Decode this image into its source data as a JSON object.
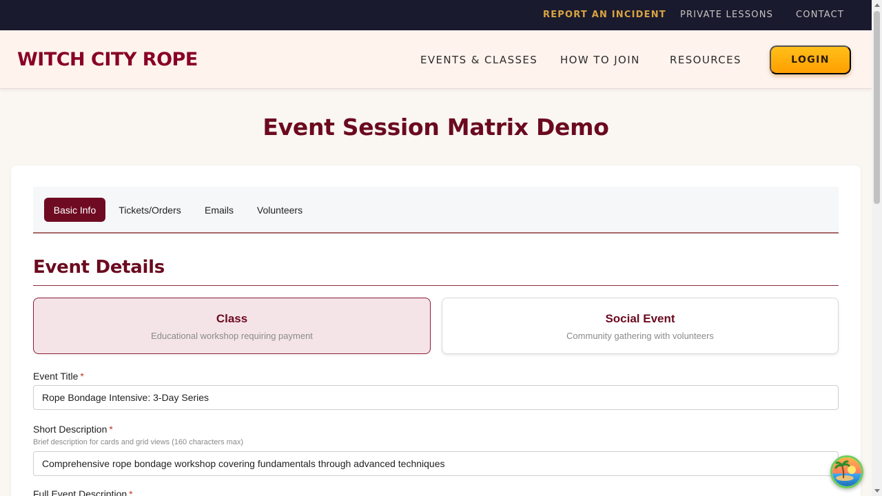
{
  "utility_nav": {
    "links": [
      "REPORT AN INCIDENT",
      "PRIVATE LESSONS",
      "CONTACT"
    ]
  },
  "header": {
    "brand": "WITCH CITY ROPE",
    "nav": [
      "EVENTS & CLASSES",
      "HOW TO JOIN",
      "RESOURCES"
    ],
    "login_label": "LOGIN"
  },
  "page": {
    "title": "Event Session Matrix Demo"
  },
  "tabs": [
    {
      "label": "Basic Info",
      "active": true
    },
    {
      "label": "Tickets/Orders",
      "active": false
    },
    {
      "label": "Emails",
      "active": false
    },
    {
      "label": "Volunteers",
      "active": false
    }
  ],
  "event_details": {
    "title": "Event Details",
    "types": [
      {
        "title": "Class",
        "subtitle": "Educational workshop requiring payment",
        "selected": true
      },
      {
        "title": "Social Event",
        "subtitle": "Community gathering with volunteers",
        "selected": false
      }
    ],
    "fields": {
      "event_title": {
        "label": "Event Title",
        "required_mark": "*",
        "value": "Rope Bondage Intensive: 3-Day Series"
      },
      "short_description": {
        "label": "Short Description",
        "required_mark": "*",
        "help": "Brief description for cards and grid views (160 characters max)",
        "value": "Comprehensive rope bondage workshop covering fundamentals through advanced techniques"
      },
      "full_description": {
        "label": "Full Event Description",
        "required_mark": "*"
      }
    }
  },
  "colors": {
    "brand": "#880124",
    "utility_bar": "#1a1a2e",
    "incident_link": "#d9a441",
    "login_button": "#ffb000",
    "active_tab": "#6e0b22",
    "selected_type_bg": "#f4e4e8"
  },
  "icons": {
    "help_fab": "palm-island-icon",
    "scroll_up": "chevron-up-icon",
    "scroll_down": "chevron-down-icon"
  }
}
